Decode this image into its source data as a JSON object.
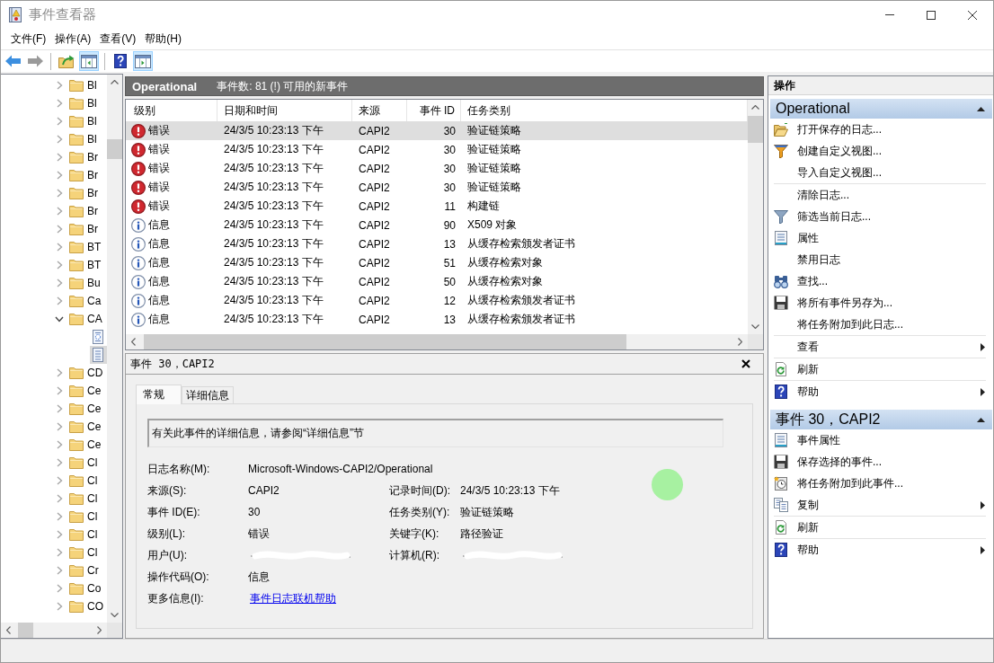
{
  "window": {
    "title": "事件查看器"
  },
  "menu": [
    "文件(F)",
    "操作(A)",
    "查看(V)",
    "帮助(H)"
  ],
  "toolbar": {
    "groups": [
      [
        {
          "pressed": false,
          "disabled": false
        },
        {
          "pressed": false,
          "disabled": true
        }
      ],
      [
        {
          "pressed": false,
          "disabled": false
        },
        {
          "pressed": true,
          "disabled": false
        }
      ],
      [
        {
          "pressed": false,
          "disabled": false
        },
        {
          "pressed": true,
          "disabled": false
        }
      ]
    ]
  },
  "tree": {
    "items": [
      {
        "label": "Bl",
        "expanded": false,
        "selected": false
      },
      {
        "label": "Bl",
        "expanded": false,
        "selected": false
      },
      {
        "label": "Bl",
        "expanded": false,
        "selected": false
      },
      {
        "label": "Bl",
        "expanded": false,
        "selected": false
      },
      {
        "label": "Br",
        "expanded": false,
        "selected": false
      },
      {
        "label": "Br",
        "expanded": false,
        "selected": false
      },
      {
        "label": "Br",
        "expanded": false,
        "selected": false
      },
      {
        "label": "Br",
        "expanded": false,
        "selected": false
      },
      {
        "label": "Br",
        "expanded": false,
        "selected": false
      },
      {
        "label": "BT",
        "expanded": false,
        "selected": false
      },
      {
        "label": "BT",
        "expanded": false,
        "selected": false
      },
      {
        "label": "Bu",
        "expanded": false,
        "selected": false
      },
      {
        "label": "Ca",
        "expanded": false,
        "selected": false
      },
      {
        "label": "CA",
        "expanded": true,
        "selected": false,
        "children": [
          {
            "selected": false
          },
          {
            "selected": true
          }
        ]
      },
      {
        "label": "CD",
        "expanded": false,
        "selected": false
      },
      {
        "label": "Ce",
        "expanded": false,
        "selected": false
      },
      {
        "label": "Ce",
        "expanded": false,
        "selected": false
      },
      {
        "label": "Ce",
        "expanded": false,
        "selected": false
      },
      {
        "label": "Ce",
        "expanded": false,
        "selected": false
      },
      {
        "label": "Cl",
        "expanded": false,
        "selected": false
      },
      {
        "label": "Cl",
        "expanded": false,
        "selected": false
      },
      {
        "label": "Cl",
        "expanded": false,
        "selected": false
      },
      {
        "label": "Cl",
        "expanded": false,
        "selected": false
      },
      {
        "label": "Cl",
        "expanded": false,
        "selected": false
      },
      {
        "label": "Cl",
        "expanded": false,
        "selected": false
      },
      {
        "label": "Cr",
        "expanded": false,
        "selected": false
      },
      {
        "label": "Co",
        "expanded": false,
        "selected": false
      },
      {
        "label": "CO",
        "expanded": false,
        "selected": false
      }
    ]
  },
  "event_list": {
    "title": "Operational",
    "summary": "事件数: 81 (!) 可用的新事件",
    "columns": [
      "级别",
      "日期和时间",
      "来源",
      "事件 ID",
      "任务类别"
    ],
    "rows": [
      {
        "kind": "error",
        "level": "错误",
        "date": "24/3/5 10:23:13 下午",
        "source": "CAPI2",
        "event_id": "30",
        "task": "验证链策略",
        "selected": true
      },
      {
        "kind": "error",
        "level": "错误",
        "date": "24/3/5 10:23:13 下午",
        "source": "CAPI2",
        "event_id": "30",
        "task": "验证链策略",
        "selected": false
      },
      {
        "kind": "error",
        "level": "错误",
        "date": "24/3/5 10:23:13 下午",
        "source": "CAPI2",
        "event_id": "30",
        "task": "验证链策略",
        "selected": false
      },
      {
        "kind": "error",
        "level": "错误",
        "date": "24/3/5 10:23:13 下午",
        "source": "CAPI2",
        "event_id": "30",
        "task": "验证链策略",
        "selected": false
      },
      {
        "kind": "error",
        "level": "错误",
        "date": "24/3/5 10:23:13 下午",
        "source": "CAPI2",
        "event_id": "11",
        "task": "构建链",
        "selected": false
      },
      {
        "kind": "info",
        "level": "信息",
        "date": "24/3/5 10:23:13 下午",
        "source": "CAPI2",
        "event_id": "90",
        "task": "X509 对象",
        "selected": false
      },
      {
        "kind": "info",
        "level": "信息",
        "date": "24/3/5 10:23:13 下午",
        "source": "CAPI2",
        "event_id": "13",
        "task": "从缓存检索颁发者证书",
        "selected": false
      },
      {
        "kind": "info",
        "level": "信息",
        "date": "24/3/5 10:23:13 下午",
        "source": "CAPI2",
        "event_id": "51",
        "task": "从缓存检索对象",
        "selected": false
      },
      {
        "kind": "info",
        "level": "信息",
        "date": "24/3/5 10:23:13 下午",
        "source": "CAPI2",
        "event_id": "50",
        "task": "从缓存检索对象",
        "selected": false
      },
      {
        "kind": "info",
        "level": "信息",
        "date": "24/3/5 10:23:13 下午",
        "source": "CAPI2",
        "event_id": "12",
        "task": "从缓存检索颁发者证书",
        "selected": false
      },
      {
        "kind": "info",
        "level": "信息",
        "date": "24/3/5 10:23:13 下午",
        "source": "CAPI2",
        "event_id": "13",
        "task": "从缓存检索颁发者证书",
        "selected": false
      }
    ]
  },
  "details": {
    "title": "事件 30，CAPI2",
    "tabs": [
      {
        "label": "常规",
        "selected": true
      },
      {
        "label": "详细信息",
        "selected": false
      }
    ],
    "message": "有关此事件的详细信息，请参阅“详细信息”节",
    "field_rows": [
      [
        {
          "label": "日志名称(M):",
          "kind": "text",
          "value": "Microsoft-Windows-CAPI2/Operational"
        }
      ],
      [
        {
          "label": "来源(S):",
          "kind": "text",
          "value": "CAPI2"
        },
        {
          "label": "记录时间(D):",
          "kind": "text",
          "value": "24/3/5 10:23:13 下午"
        }
      ],
      [
        {
          "label": "事件 ID(E):",
          "kind": "text",
          "value": "30"
        },
        {
          "label": "任务类别(Y):",
          "kind": "text",
          "value": "验证链策略"
        }
      ],
      [
        {
          "label": "级别(L):",
          "kind": "text",
          "value": "错误"
        },
        {
          "label": "关键字(K):",
          "kind": "text",
          "value": "路径验证"
        }
      ],
      [
        {
          "label": "用户(U):",
          "kind": "redacted"
        },
        {
          "label": "计算机(R):",
          "kind": "redacted"
        }
      ],
      [
        {
          "label": "操作代码(O):",
          "kind": "text",
          "value": "信息"
        }
      ],
      [
        {
          "label": "更多信息(I):",
          "kind": "link",
          "value": "事件日志联机帮助"
        }
      ]
    ]
  },
  "actions": {
    "title": "操作",
    "sections": [
      {
        "title": "Operational",
        "expanded": true,
        "groups": [
          [
            {
              "label": "打开保存的日志...",
              "submenu": false
            },
            {
              "label": "创建自定义视图...",
              "submenu": false
            },
            {
              "label": "导入自定义视图...",
              "submenu": false
            }
          ],
          [
            {
              "label": "清除日志...",
              "submenu": false
            },
            {
              "label": "筛选当前日志...",
              "submenu": false
            },
            {
              "label": "属性",
              "submenu": false
            },
            {
              "label": "禁用日志",
              "submenu": false
            },
            {
              "label": "查找...",
              "submenu": false
            },
            {
              "label": "将所有事件另存为...",
              "submenu": false
            },
            {
              "label": "将任务附加到此日志...",
              "submenu": false
            }
          ],
          [
            {
              "label": "查看",
              "submenu": true
            }
          ],
          [
            {
              "label": "刷新",
              "submenu": false
            }
          ],
          [
            {
              "label": "帮助",
              "submenu": true
            }
          ]
        ]
      },
      {
        "title": "事件 30，CAPI2",
        "expanded": true,
        "groups": [
          [
            {
              "label": "事件属性",
              "submenu": false
            },
            {
              "label": "保存选择的事件...",
              "submenu": false
            },
            {
              "label": "将任务附加到此事件...",
              "submenu": false
            },
            {
              "label": "复制",
              "submenu": true
            }
          ],
          [
            {
              "label": "刷新",
              "submenu": false
            }
          ],
          [
            {
              "label": "帮助",
              "submenu": true
            }
          ]
        ]
      }
    ]
  }
}
